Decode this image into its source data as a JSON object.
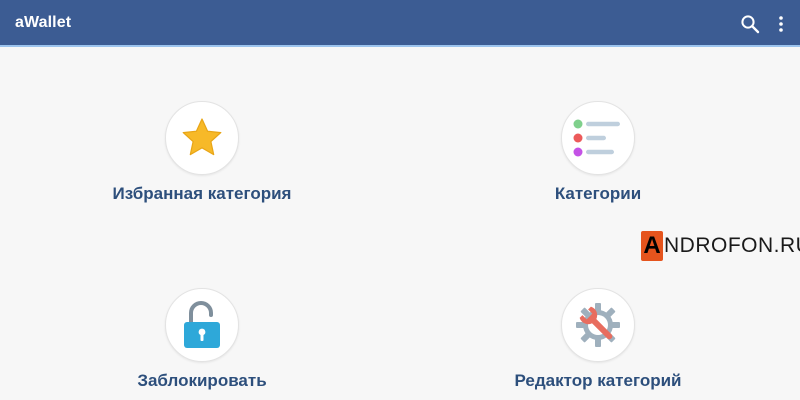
{
  "app": {
    "title": "aWallet"
  },
  "toolbar": {
    "search_icon": "search-icon",
    "more_icon": "more-vert-icon"
  },
  "tiles": [
    {
      "label": "Избранная категория",
      "icon": "star-icon"
    },
    {
      "label": "Категории",
      "icon": "category-list-icon"
    },
    {
      "label": "Заблокировать",
      "icon": "unlock-icon"
    },
    {
      "label": "Редактор категорий",
      "icon": "gear-wrench-icon"
    }
  ],
  "watermark": {
    "first_letter": "A",
    "rest": "NDROFON.RU"
  },
  "colors": {
    "appbar": "#3c5c93",
    "appbar_underline": "#9cc4ee",
    "label": "#2d4f7c",
    "background": "#f7f7f7",
    "star": "#f7b928",
    "lock": "#2ea8d9",
    "wrench": "#e86d5f",
    "gear": "#9fb0bd"
  }
}
